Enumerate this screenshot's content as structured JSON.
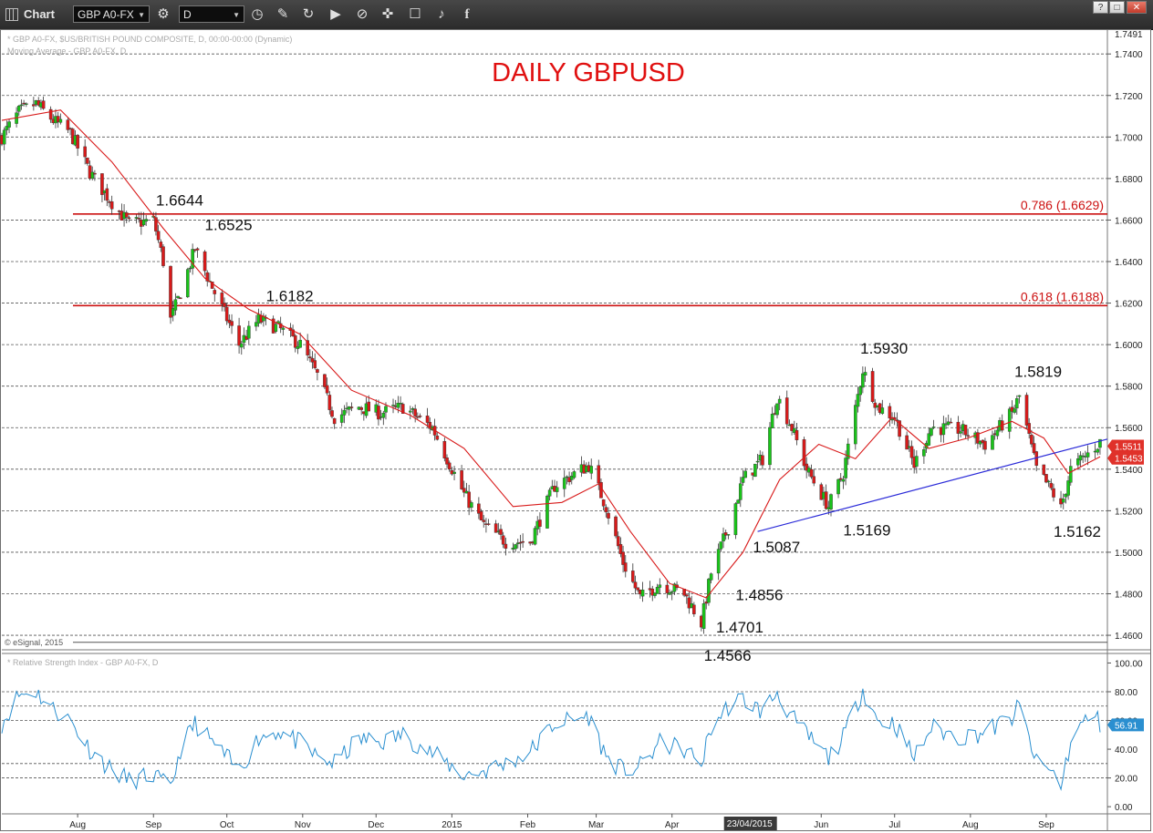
{
  "toolbar": {
    "app_label": "Chart",
    "symbol": "GBP A0-FX",
    "interval": "D",
    "icons": [
      "grid-icon",
      "settings-icon",
      "clock-icon",
      "pencil-icon",
      "cycle-icon",
      "play-icon",
      "link-icon",
      "crosshair-icon",
      "comment-icon",
      "twitter-icon",
      "facebook-icon"
    ],
    "window_buttons": [
      "?",
      "□",
      "✕"
    ]
  },
  "chart_data": [
    {
      "type": "line",
      "title": "DAILY GBPUSD",
      "header": "* GBP A0-FX, $US/BRITISH POUND COMPOSITE, D, 00:00-00:00 (Dynamic)",
      "subheader": "Moving Average - GBP A0-FX, D",
      "copyright": "© eSignal, 2015",
      "price_style": "candlestick",
      "up_color": "#19c419",
      "down_color": "#d91a1a",
      "ylim": [
        1.453,
        1.7515
      ],
      "y_ticks": [
        "1.7400",
        "1.7200",
        "1.7000",
        "1.6800",
        "1.6600",
        "1.6400",
        "1.6200",
        "1.6000",
        "1.5800",
        "1.5600",
        "1.5400",
        "1.5200",
        "1.5000",
        "1.4800",
        "1.4600"
      ],
      "top_label": "1.7491",
      "last_price": "1.5511",
      "ma_value": "1.5453",
      "x_labels": [
        {
          "label": "Aug",
          "x": "2014-08-01"
        },
        {
          "label": "Sep",
          "x": "2014-09-01"
        },
        {
          "label": "Oct",
          "x": "2014-10-01"
        },
        {
          "label": "Nov",
          "x": "2014-11-01"
        },
        {
          "label": "Dec",
          "x": "2014-12-01"
        },
        {
          "label": "2015",
          "x": "2015-01-01"
        },
        {
          "label": "Feb",
          "x": "2015-02-01"
        },
        {
          "label": "Mar",
          "x": "2015-03-01"
        },
        {
          "label": "Apr",
          "x": "2015-04-01"
        },
        {
          "label": "23/04/2015",
          "x": "2015-04-23"
        },
        {
          "label": "Jun",
          "x": "2015-06-01"
        },
        {
          "label": "Jul",
          "x": "2015-07-01"
        },
        {
          "label": "Aug",
          "x": "2015-08-01"
        },
        {
          "label": "Sep",
          "x": "2015-09-01"
        }
      ],
      "price_path": [
        [
          "2014-07-01",
          1.7
        ],
        [
          "2014-07-08",
          1.712
        ],
        [
          "2014-07-15",
          1.716
        ],
        [
          "2014-07-22",
          1.708
        ],
        [
          "2014-07-29",
          1.702
        ],
        [
          "2014-08-06",
          1.683
        ],
        [
          "2014-08-14",
          1.67
        ],
        [
          "2014-08-22",
          1.658
        ],
        [
          "2014-09-01",
          1.66
        ],
        [
          "2014-09-05",
          1.64
        ],
        [
          "2014-09-08",
          1.612
        ],
        [
          "2014-09-12",
          1.625
        ],
        [
          "2014-09-18",
          1.646
        ],
        [
          "2014-09-26",
          1.625
        ],
        [
          "2014-10-06",
          1.6
        ],
        [
          "2014-10-14",
          1.612
        ],
        [
          "2014-10-22",
          1.608
        ],
        [
          "2014-10-31",
          1.6
        ],
        [
          "2014-11-07",
          1.585
        ],
        [
          "2014-11-14",
          1.565
        ],
        [
          "2014-11-24",
          1.57
        ],
        [
          "2014-12-03",
          1.567
        ],
        [
          "2014-12-12",
          1.57
        ],
        [
          "2014-12-24",
          1.56
        ],
        [
          "2015-01-06",
          1.528
        ],
        [
          "2015-01-14",
          1.513
        ],
        [
          "2015-01-23",
          1.505
        ],
        [
          "2015-02-02",
          1.505
        ],
        [
          "2015-02-12",
          1.532
        ],
        [
          "2015-02-26",
          1.542
        ],
        [
          "2015-03-05",
          1.522
        ],
        [
          "2015-03-12",
          1.495
        ],
        [
          "2015-03-19",
          1.478
        ],
        [
          "2015-03-27",
          1.485
        ],
        [
          "2015-04-06",
          1.48
        ],
        [
          "2015-04-13",
          1.466
        ],
        [
          "2015-04-17",
          1.49
        ],
        [
          "2015-04-24",
          1.512
        ],
        [
          "2015-04-30",
          1.535
        ],
        [
          "2015-05-08",
          1.545
        ],
        [
          "2015-05-14",
          1.575
        ],
        [
          "2015-05-20",
          1.56
        ],
        [
          "2015-05-26",
          1.54
        ],
        [
          "2015-06-04",
          1.522
        ],
        [
          "2015-06-10",
          1.538
        ],
        [
          "2015-06-18",
          1.588
        ],
        [
          "2015-06-24",
          1.57
        ],
        [
          "2015-07-01",
          1.565
        ],
        [
          "2015-07-09",
          1.542
        ],
        [
          "2015-07-16",
          1.56
        ],
        [
          "2015-07-28",
          1.559
        ],
        [
          "2015-08-07",
          1.552
        ],
        [
          "2015-08-18",
          1.567
        ],
        [
          "2015-08-21",
          1.575
        ],
        [
          "2015-08-28",
          1.54
        ],
        [
          "2015-09-03",
          1.53
        ],
        [
          "2015-09-07",
          1.521
        ],
        [
          "2015-09-11",
          1.54
        ],
        [
          "2015-09-16",
          1.545
        ],
        [
          "2015-09-23",
          1.553
        ]
      ],
      "moving_average_path": [
        [
          "2014-07-01",
          1.708
        ],
        [
          "2014-07-25",
          1.713
        ],
        [
          "2014-08-15",
          1.688
        ],
        [
          "2014-09-05",
          1.656
        ],
        [
          "2014-09-22",
          1.632
        ],
        [
          "2014-10-10",
          1.617
        ],
        [
          "2014-10-31",
          1.605
        ],
        [
          "2014-11-21",
          1.578
        ],
        [
          "2014-12-15",
          1.566
        ],
        [
          "2015-01-06",
          1.55
        ],
        [
          "2015-01-26",
          1.522
        ],
        [
          "2015-02-15",
          1.524
        ],
        [
          "2015-03-02",
          1.533
        ],
        [
          "2015-03-15",
          1.51
        ],
        [
          "2015-03-31",
          1.485
        ],
        [
          "2015-04-15",
          1.478
        ],
        [
          "2015-04-30",
          1.5
        ],
        [
          "2015-05-15",
          1.535
        ],
        [
          "2015-05-31",
          1.552
        ],
        [
          "2015-06-15",
          1.545
        ],
        [
          "2015-06-30",
          1.565
        ],
        [
          "2015-07-15",
          1.55
        ],
        [
          "2015-07-31",
          1.555
        ],
        [
          "2015-08-18",
          1.563
        ],
        [
          "2015-08-31",
          1.555
        ],
        [
          "2015-09-10",
          1.538
        ],
        [
          "2015-09-23",
          1.546
        ]
      ],
      "horizontal_lines": [
        {
          "label": "0.786 (1.6629)",
          "y": 1.6629,
          "color": "#cc1111"
        },
        {
          "label": "0.618 (1.6188)",
          "y": 1.6188,
          "color": "#cc1111"
        },
        {
          "label": "",
          "y": 1.4566,
          "color": "#555555"
        }
      ],
      "trendline": {
        "from": [
          "2015-05-06",
          1.51
        ],
        "to": [
          "2015-09-26",
          1.5545
        ],
        "color": "#2a2ad8"
      },
      "annotations": [
        {
          "text": "1.6644",
          "x": "2014-09-02",
          "y": 1.6644,
          "anchor": "bottom"
        },
        {
          "text": "1.6525",
          "x": "2014-09-22",
          "y": 1.6525,
          "anchor": "bottom"
        },
        {
          "text": "1.6182",
          "x": "2014-10-17",
          "y": 1.6182,
          "anchor": "bottom"
        },
        {
          "text": "1.5087",
          "x": "2015-05-04",
          "y": 1.5087,
          "anchor": "top"
        },
        {
          "text": "1.4856",
          "x": "2015-04-27",
          "y": 1.4856,
          "anchor": "top"
        },
        {
          "text": "1.4701",
          "x": "2015-04-19",
          "y": 1.4701,
          "anchor": "top"
        },
        {
          "text": "1.4566",
          "x": "2015-04-14",
          "y": 1.4566,
          "anchor": "top"
        },
        {
          "text": "1.5169",
          "x": "2015-06-10",
          "y": 1.5169,
          "anchor": "top"
        },
        {
          "text": "1.5930",
          "x": "2015-06-17",
          "y": 1.593,
          "anchor": "bottom"
        },
        {
          "text": "1.5819",
          "x": "2015-08-19",
          "y": 1.5819,
          "anchor": "bottom"
        },
        {
          "text": "1.5162",
          "x": "2015-09-04",
          "y": 1.5162,
          "anchor": "top"
        }
      ]
    },
    {
      "type": "line",
      "title": "* Relative Strength Index - GBP A0-FX, D",
      "ylim": [
        -5,
        106
      ],
      "y_ticks": [
        "100.00",
        "80.00",
        "60.00",
        "40.00",
        "20.00",
        "0.00"
      ],
      "ref_lines": [
        80,
        70,
        60,
        30,
        20
      ],
      "last_value": "56.91",
      "color": "#2a8fd0",
      "path": [
        [
          "2014-07-01",
          58
        ],
        [
          "2014-07-08",
          78
        ],
        [
          "2014-07-15",
          80
        ],
        [
          "2014-07-22",
          68
        ],
        [
          "2014-07-29",
          60
        ],
        [
          "2014-08-06",
          40
        ],
        [
          "2014-08-14",
          27
        ],
        [
          "2014-08-22",
          18
        ],
        [
          "2014-09-01",
          22
        ],
        [
          "2014-09-05",
          16
        ],
        [
          "2014-09-08",
          12
        ],
        [
          "2014-09-12",
          40
        ],
        [
          "2014-09-18",
          58
        ],
        [
          "2014-09-26",
          43
        ],
        [
          "2014-10-06",
          25
        ],
        [
          "2014-10-14",
          48
        ],
        [
          "2014-10-22",
          53
        ],
        [
          "2014-10-31",
          44
        ],
        [
          "2014-11-07",
          34
        ],
        [
          "2014-11-14",
          30
        ],
        [
          "2014-11-24",
          47
        ],
        [
          "2014-12-03",
          45
        ],
        [
          "2014-12-12",
          50
        ],
        [
          "2014-12-24",
          37
        ],
        [
          "2015-01-06",
          22
        ],
        [
          "2015-01-14",
          25
        ],
        [
          "2015-01-23",
          30
        ],
        [
          "2015-02-02",
          38
        ],
        [
          "2015-02-12",
          58
        ],
        [
          "2015-02-26",
          63
        ],
        [
          "2015-03-05",
          35
        ],
        [
          "2015-03-12",
          25
        ],
        [
          "2015-03-19",
          28
        ],
        [
          "2015-03-27",
          44
        ],
        [
          "2015-04-06",
          40
        ],
        [
          "2015-04-13",
          30
        ],
        [
          "2015-04-17",
          55
        ],
        [
          "2015-04-24",
          70
        ],
        [
          "2015-04-30",
          75
        ],
        [
          "2015-05-08",
          66
        ],
        [
          "2015-05-14",
          80
        ],
        [
          "2015-05-20",
          62
        ],
        [
          "2015-05-26",
          50
        ],
        [
          "2015-06-04",
          34
        ],
        [
          "2015-06-10",
          48
        ],
        [
          "2015-06-18",
          82
        ],
        [
          "2015-06-24",
          60
        ],
        [
          "2015-07-01",
          58
        ],
        [
          "2015-07-09",
          34
        ],
        [
          "2015-07-16",
          55
        ],
        [
          "2015-07-28",
          48
        ],
        [
          "2015-08-07",
          52
        ],
        [
          "2015-08-18",
          62
        ],
        [
          "2015-08-21",
          70
        ],
        [
          "2015-08-28",
          30
        ],
        [
          "2015-09-03",
          25
        ],
        [
          "2015-09-07",
          15
        ],
        [
          "2015-09-11",
          45
        ],
        [
          "2015-09-16",
          58
        ],
        [
          "2015-09-20",
          66
        ],
        [
          "2015-09-23",
          57
        ]
      ]
    }
  ]
}
